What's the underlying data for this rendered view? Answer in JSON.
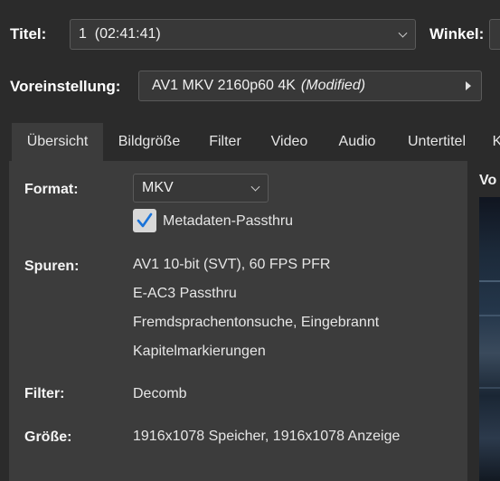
{
  "header": {
    "title_label": "Titel:",
    "title_value": "1  (02:41:41)",
    "angle_label": "Winkel:",
    "preset_label": "Voreinstellung:",
    "preset_value": "AV1 MKV 2160p60 4K",
    "preset_modified": "(Modified)"
  },
  "tabs": [
    {
      "label": "Übersicht",
      "active": true
    },
    {
      "label": "Bildgröße",
      "active": false
    },
    {
      "label": "Filter",
      "active": false
    },
    {
      "label": "Video",
      "active": false
    },
    {
      "label": "Audio",
      "active": false
    },
    {
      "label": "Untertitel",
      "active": false
    },
    {
      "label": "K",
      "active": false
    }
  ],
  "summary": {
    "format_label": "Format:",
    "format_value": "MKV",
    "metadata_label": "Metadaten-Passthru",
    "metadata_checked": true,
    "tracks_label": "Spuren:",
    "tracks": [
      "AV1 10-bit (SVT), 60 FPS PFR",
      "E-AC3 Passthru",
      "Fremdsprachentonsuche, Eingebrannt",
      "Kapitelmarkierungen"
    ],
    "filter_label": "Filter:",
    "filter_value": "Decomb",
    "size_label": "Größe:",
    "size_value": "1916x1078 Speicher, 1916x1078 Anzeige"
  },
  "preview": {
    "label": "Vo"
  },
  "colors": {
    "background": "#2b2b2b",
    "panel": "#3c3c3c",
    "checkmark": "#1a73d9"
  }
}
